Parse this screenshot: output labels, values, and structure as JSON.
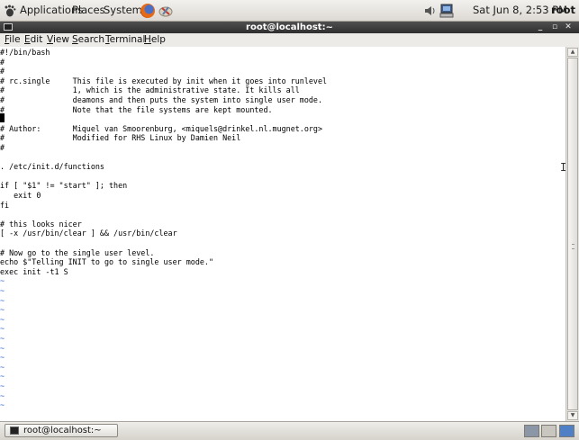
{
  "top_panel": {
    "menus": [
      "Applications",
      "Places",
      "System"
    ],
    "clock": "Sat Jun  8,  2:53 PM",
    "user": "root",
    "icons": [
      "gnome-foot-icon",
      "firefox-icon",
      "tools-icon",
      "volume-icon",
      "network-icon"
    ]
  },
  "window": {
    "title": "root@localhost:~",
    "controls": {
      "minimize": "_",
      "maximize": "▫",
      "close": "✕"
    }
  },
  "menubar": {
    "items": [
      {
        "label": "File",
        "key": "F",
        "rest": "ile"
      },
      {
        "label": "Edit",
        "key": "E",
        "rest": "dit"
      },
      {
        "label": "View",
        "key": "V",
        "rest": "iew"
      },
      {
        "label": "Search",
        "key": "S",
        "rest": "earch"
      },
      {
        "label": "Terminal",
        "key": "T",
        "rest": "erminal"
      },
      {
        "label": "Help",
        "key": "H",
        "rest": "elp"
      }
    ]
  },
  "terminal": {
    "lines": [
      "#!/bin/bash",
      "#",
      "#",
      "# rc.single     This file is executed by init when it goes into runlevel",
      "#               1, which is the administrative state. It kills all",
      "#               deamons and then puts the system into single user mode.",
      "#               Note that the file systems are kept mounted.",
      "#",
      "# Author:       Miquel van Smoorenburg, <miquels@drinkel.nl.mugnet.org>",
      "#               Modified for RHS Linux by Damien Neil",
      "#",
      "",
      ". /etc/init.d/functions",
      "",
      "if [ \"$1\" != \"start\" ]; then",
      "   exit 0",
      "fi",
      "",
      "# this looks nicer",
      "[ -x /usr/bin/clear ] && /usr/bin/clear",
      "",
      "# Now go to the single user level.",
      "echo $\"Telling INIT to go to single user mode.\"",
      "exec init -t1 S"
    ],
    "tilde_char": "~",
    "tilde_count": 14
  },
  "taskbar": {
    "window_button": "root@localhost:~"
  }
}
